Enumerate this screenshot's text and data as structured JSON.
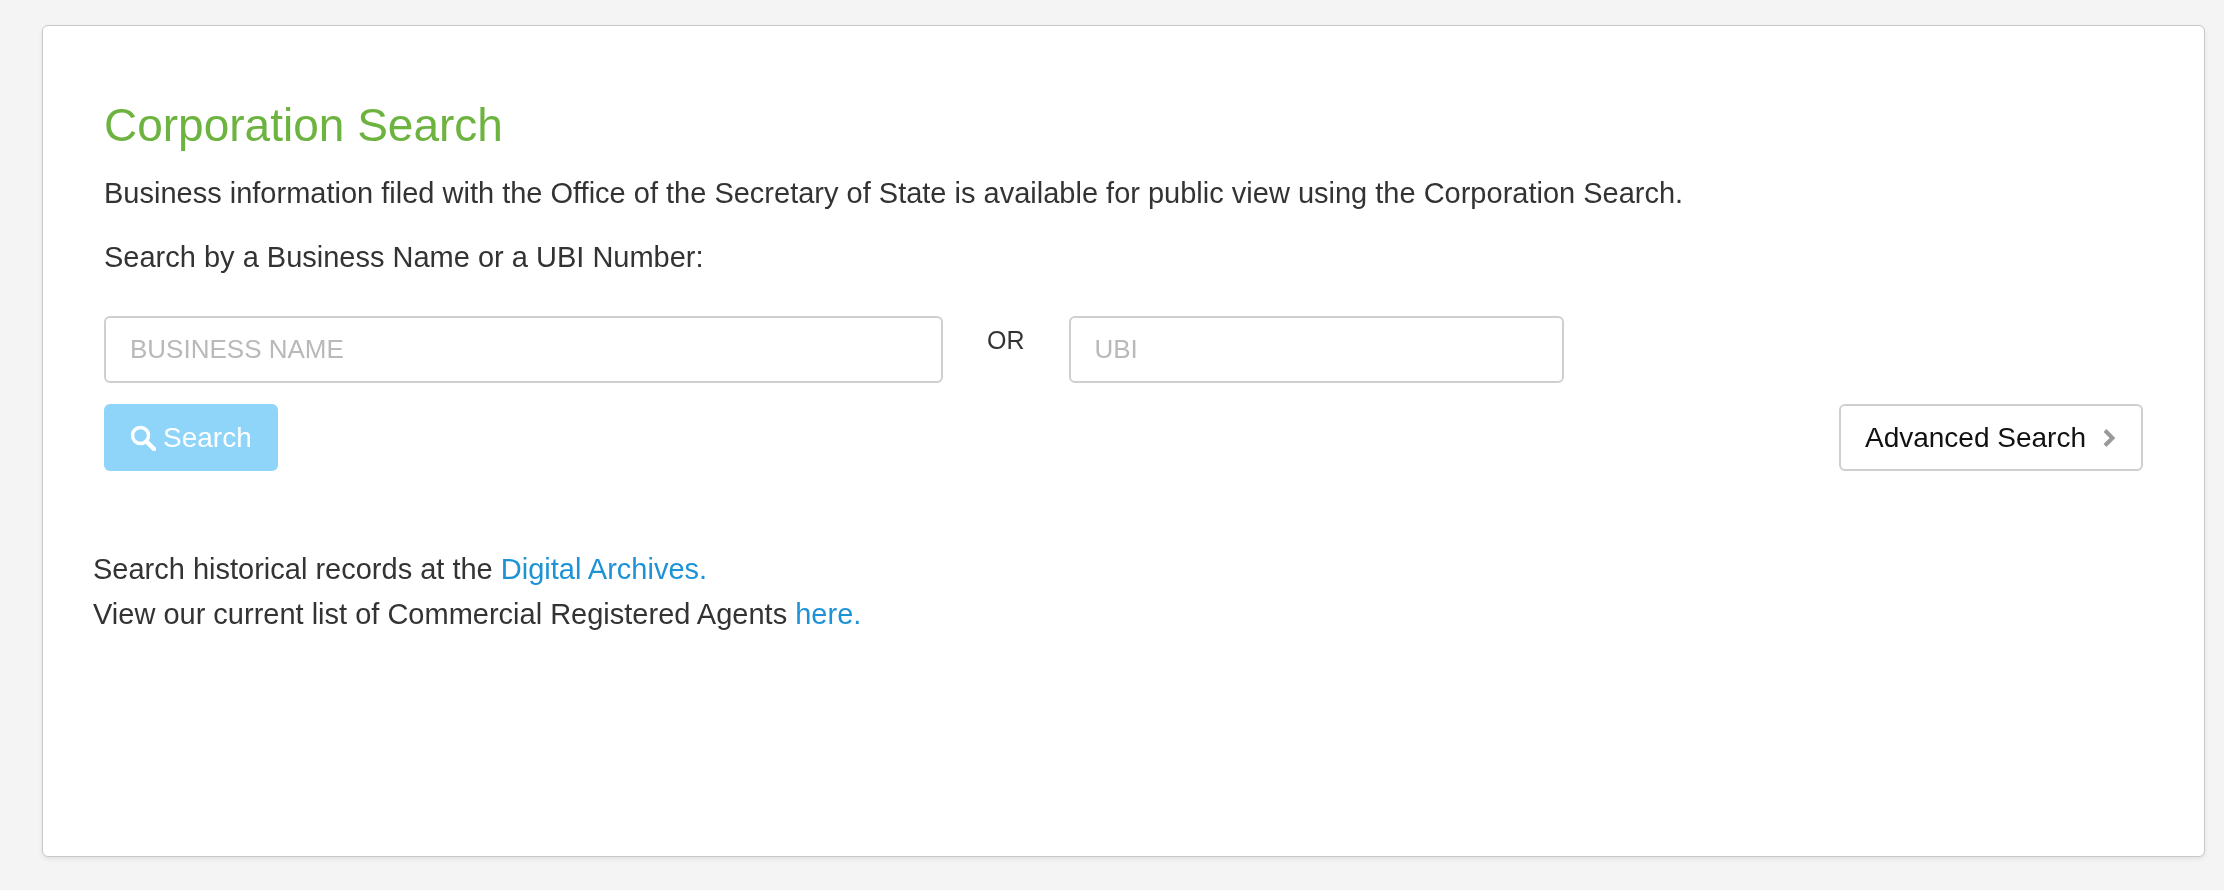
{
  "header": {
    "title": "Corporation Search",
    "intro": "Business information filed with the Office of the Secretary of State is available for public view using the Corporation Search.",
    "prompt": "Search by a Business Name or a UBI Number:"
  },
  "form": {
    "business_name": {
      "placeholder": "BUSINESS NAME"
    },
    "separator": "OR",
    "ubi": {
      "placeholder": "UBI"
    },
    "search_button": {
      "label": "Search",
      "disabled": true
    },
    "advanced_button": {
      "label": "Advanced Search"
    }
  },
  "notes": [
    {
      "text": "Search historical records at the",
      "link": "Digital Archives."
    },
    {
      "text": "View our current list of Commercial Registered Agents",
      "link": "here."
    }
  ]
}
